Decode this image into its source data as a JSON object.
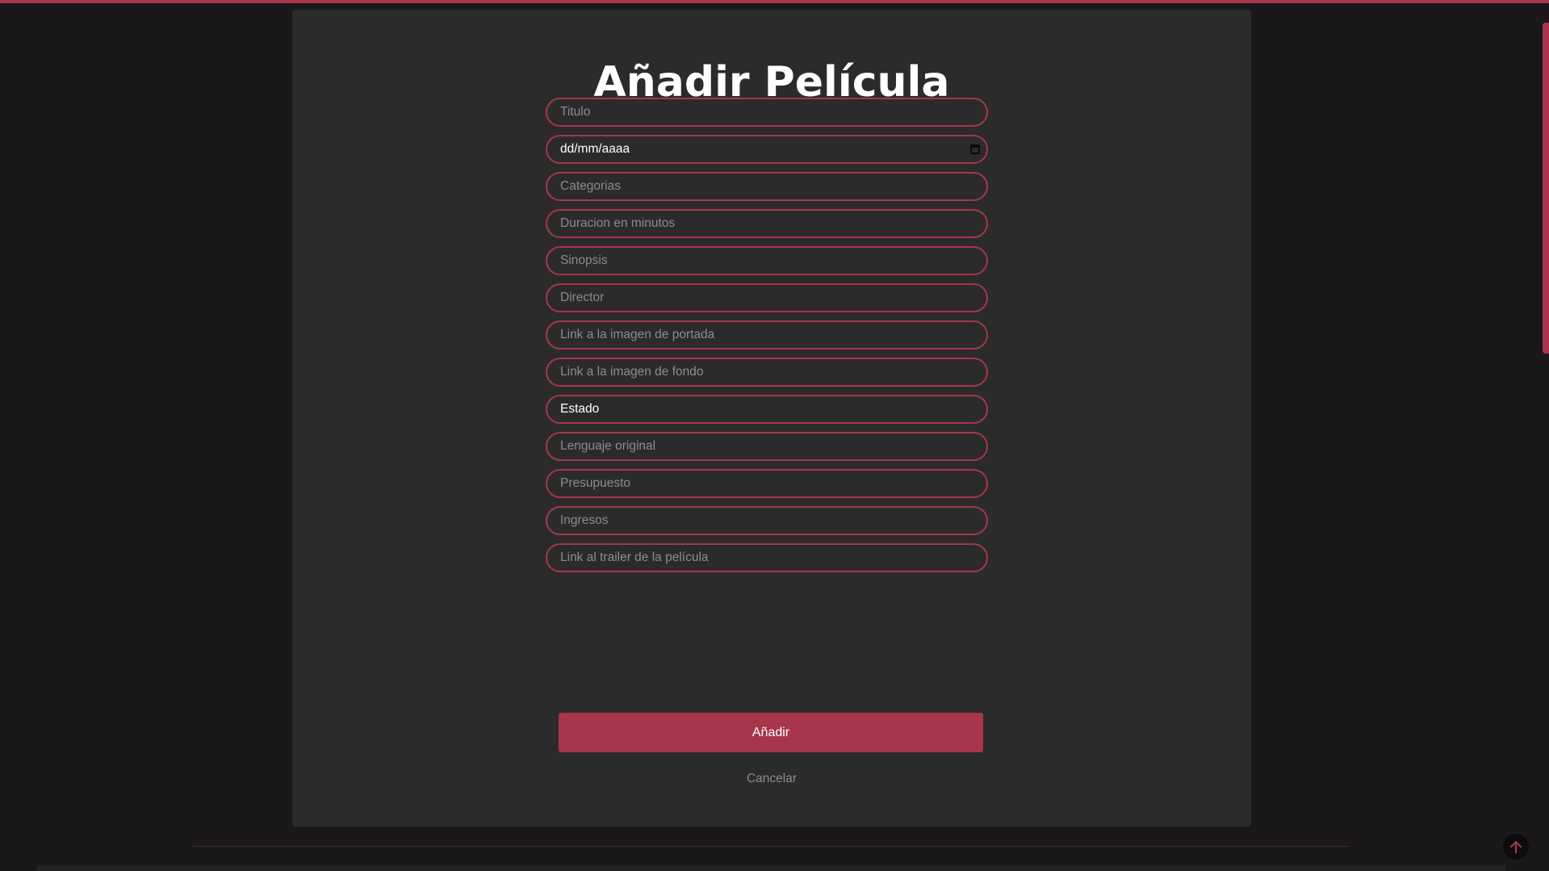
{
  "page": {
    "title": "Añadir Película"
  },
  "form": {
    "fields": [
      {
        "placeholder": "Titulo",
        "value": ""
      },
      {
        "placeholder": "",
        "value": "dd/mm/aaaa",
        "type": "date"
      },
      {
        "placeholder": "Categorias",
        "value": ""
      },
      {
        "placeholder": "Duracion en minutos",
        "value": ""
      },
      {
        "placeholder": "Sinopsis",
        "value": ""
      },
      {
        "placeholder": "Director",
        "value": ""
      },
      {
        "placeholder": "Link a la imagen de portada",
        "value": ""
      },
      {
        "placeholder": "Link a la imagen de fondo",
        "value": ""
      },
      {
        "placeholder": "",
        "value": "Estado",
        "type": "select"
      },
      {
        "placeholder": "Lenguaje original",
        "value": ""
      },
      {
        "placeholder": "Presupuesto",
        "value": ""
      },
      {
        "placeholder": "Ingresos",
        "value": ""
      },
      {
        "placeholder": "Link al trailer de la película",
        "value": ""
      }
    ],
    "submit_label": "Añadir",
    "cancel_label": "Cancelar"
  },
  "icons": {
    "date_picker": "calendar-icon",
    "back_to_top": "arrow-up-icon"
  },
  "colors": {
    "accent": "#a8364a",
    "background": "#1b181c",
    "card": "#2b2b2b",
    "placeholder_text": "#8c8c8c",
    "text": "#ffffff"
  }
}
